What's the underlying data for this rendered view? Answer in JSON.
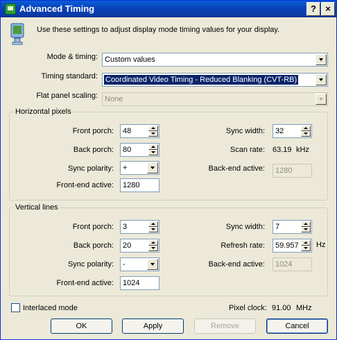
{
  "window": {
    "title": "Advanced Timing",
    "help_label": "?",
    "close_label": "×"
  },
  "info": {
    "text": "Use these settings to adjust display mode timing values for your display."
  },
  "top": {
    "mode_timing_label": "Mode & timing:",
    "mode_timing_value": "Custom values",
    "timing_standard_label": "Timing standard:",
    "timing_standard_value": "Coordinated Video Timing - Reduced Blanking (CVT-RB)",
    "flat_panel_label": "Flat panel scaling:",
    "flat_panel_value": "None"
  },
  "horizontal": {
    "title": "Horizontal pixels",
    "front_porch_label": "Front porch:",
    "front_porch_value": "48",
    "back_porch_label": "Back porch:",
    "back_porch_value": "80",
    "sync_polarity_label": "Sync polarity:",
    "sync_polarity_value": "+",
    "front_end_active_label": "Front-end active:",
    "front_end_active_value": "1280",
    "sync_width_label": "Sync width:",
    "sync_width_value": "32",
    "scan_rate_label": "Scan rate:",
    "scan_rate_value": "63.19",
    "scan_rate_unit": "kHz",
    "back_end_active_label": "Back-end active:",
    "back_end_active_value": "1280"
  },
  "vertical": {
    "title": "Vertical lines",
    "front_porch_label": "Front porch:",
    "front_porch_value": "3",
    "back_porch_label": "Back porch:",
    "back_porch_value": "20",
    "sync_polarity_label": "Sync polarity:",
    "sync_polarity_value": "-",
    "front_end_active_label": "Front-end active:",
    "front_end_active_value": "1024",
    "sync_width_label": "Sync width:",
    "sync_width_value": "7",
    "refresh_rate_label": "Refresh rate:",
    "refresh_rate_value": "59.957",
    "refresh_rate_unit": "Hz",
    "back_end_active_label": "Back-end active:",
    "back_end_active_value": "1024"
  },
  "footer": {
    "interlaced_label": "Interlaced mode",
    "interlaced_checked": false,
    "pixel_clock_label": "Pixel clock:",
    "pixel_clock_value": "91.00",
    "pixel_clock_unit": "MHz"
  },
  "buttons": {
    "ok": "OK",
    "apply": "Apply",
    "remove": "Remove",
    "cancel": "Cancel"
  },
  "icons": {
    "title": "display-settings-icon",
    "info": "monitor-info-icon"
  },
  "colors": {
    "titlebar": "#0a4fc7",
    "selection": "#0a246a",
    "dialog_bg": "#ece9d8"
  }
}
